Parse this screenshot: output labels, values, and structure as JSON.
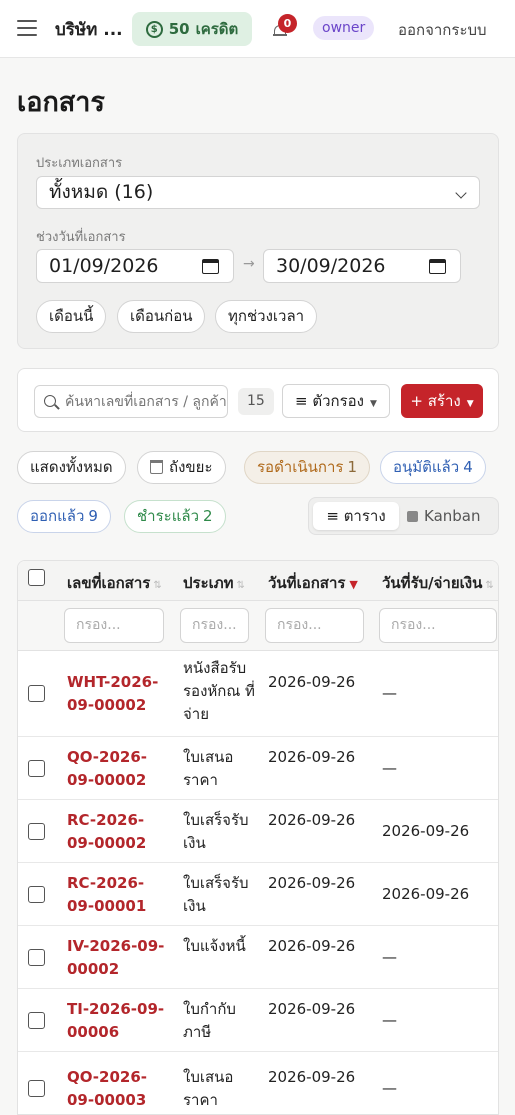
{
  "header": {
    "company": "บริษัท ...",
    "credit_amount": "50",
    "credit_label": "เครดิต",
    "notifications": "0",
    "role": "owner",
    "logout": "ออกจากระบบ"
  },
  "page": {
    "title": "เอกสาร"
  },
  "filters": {
    "type_label": "ประเภทเอกสาร",
    "type_value": "ทั้งหมด (16)",
    "range_label": "ช่วงวันที่เอกสาร",
    "date_from": "01/09/2026",
    "date_to": "30/09/2026",
    "quick": [
      "เดือนนี้",
      "เดือนก่อน",
      "ทุกช่วงเวลา"
    ]
  },
  "toolbar": {
    "search_placeholder": "ค้นหาเลขที่เอกสาร / ลูกค้า",
    "count": "15",
    "filter_label": "ตัวกรอง",
    "create_label": "+ สร้าง"
  },
  "status_chips": {
    "show_all": "แสดงทั้งหมด",
    "trash": "ถังขยะ",
    "pending": {
      "label": "รอดำเนินการ",
      "count": "1"
    },
    "approved": {
      "label": "อนุมัติแล้ว",
      "count": "4"
    },
    "issued": {
      "label": "ออกแล้ว",
      "count": "9"
    },
    "paid": {
      "label": "ชำระแล้ว",
      "count": "2"
    }
  },
  "view_toggle": {
    "table": "ตาราง",
    "kanban": "Kanban"
  },
  "table": {
    "columns": [
      "เลขที่เอกสาร",
      "ประเภท",
      "วันที่เอกสาร",
      "วันที่รับ/จ่ายเงิน"
    ],
    "filter_placeholder": "กรอง...",
    "rows": [
      {
        "doc_no": "WHT-2026-09-00002",
        "type": "หนังสือรับรองหักณ ที่จ่าย",
        "date": "2026-09-26",
        "pay_date": "—"
      },
      {
        "doc_no": "QO-2026-09-00002",
        "type": "ใบเสนอราคา",
        "date": "2026-09-26",
        "pay_date": "—"
      },
      {
        "doc_no": "RC-2026-09-00002",
        "type": "ใบเสร็จรับเงิน",
        "date": "2026-09-26",
        "pay_date": "2026-09-26"
      },
      {
        "doc_no": "RC-2026-09-00001",
        "type": "ใบเสร็จรับเงิน",
        "date": "2026-09-26",
        "pay_date": "2026-09-26"
      },
      {
        "doc_no": "IV-2026-09-00002",
        "type": "ใบแจ้งหนี้",
        "date": "2026-09-26",
        "pay_date": "—"
      },
      {
        "doc_no": "TI-2026-09-00006",
        "type": "ใบกำกับภาษี",
        "date": "2026-09-26",
        "pay_date": "—"
      },
      {
        "doc_no": "QO-2026-09-00003",
        "type": "ใบเสนอราคา",
        "date": "2026-09-26",
        "pay_date": "—"
      }
    ]
  },
  "colors": {
    "brand_red": "#c5242a",
    "credit_green": "#2e6b3f",
    "role_purple": "#6b45c9",
    "pending_orange": "#b06a1c",
    "approved_blue": "#2f5fb3",
    "paid_green": "#2f8a4a"
  }
}
